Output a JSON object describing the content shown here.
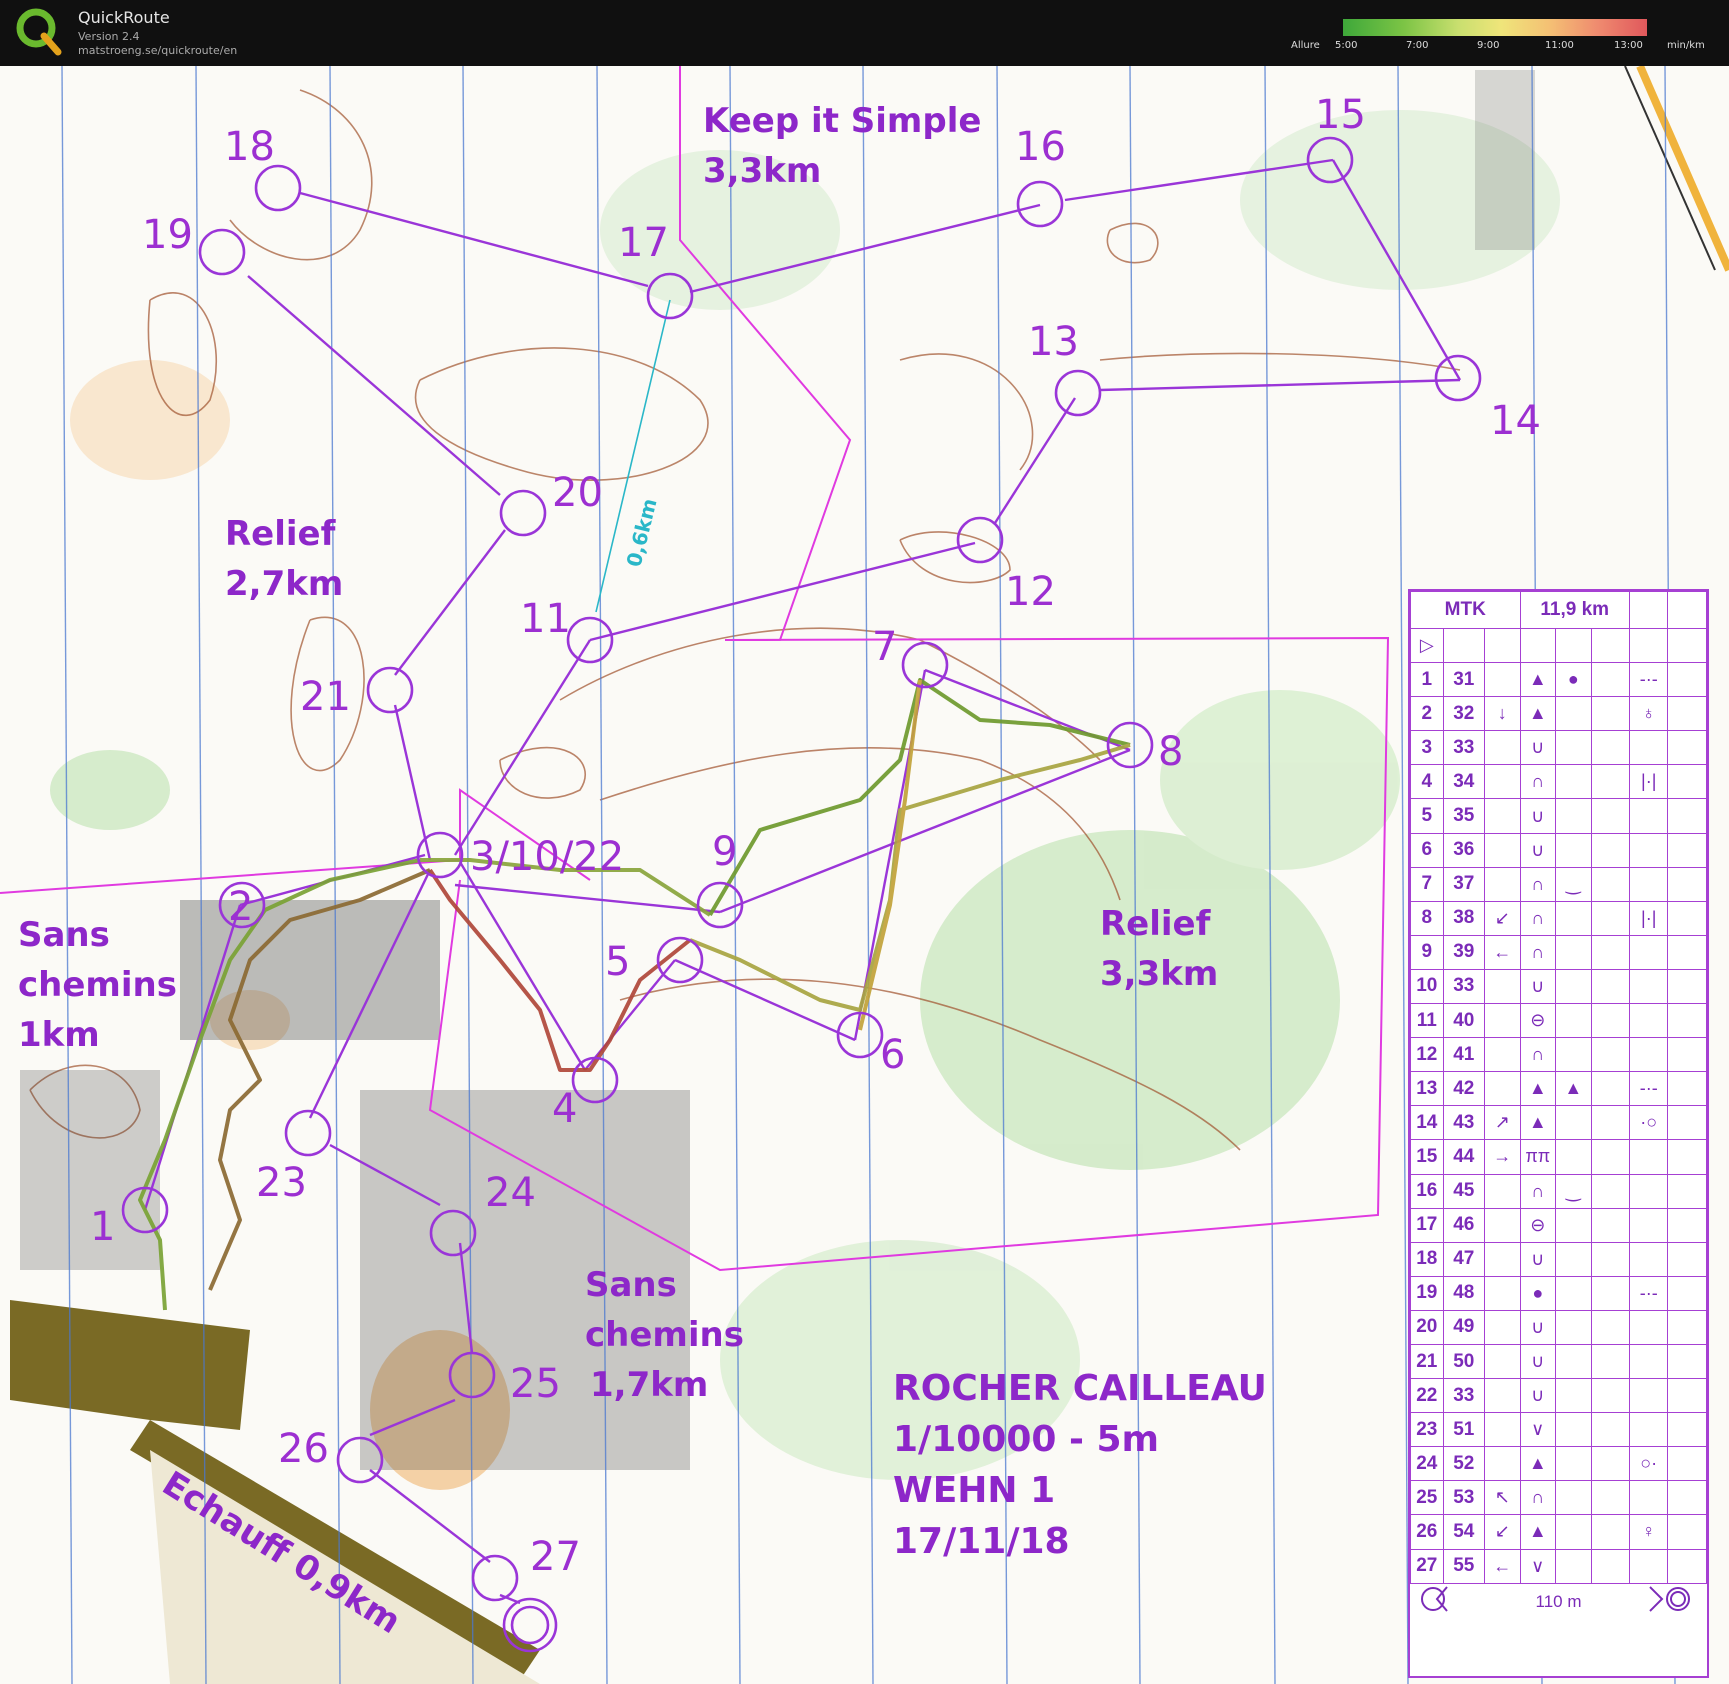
{
  "app": {
    "name": "QuickRoute",
    "version": "Version 2.4",
    "url": "matstroeng.se/quickroute/en"
  },
  "pace_legend": {
    "label": "Allure",
    "ticks": [
      "5:00",
      "7:00",
      "9:00",
      "11:00",
      "13:00"
    ],
    "unit": "min/km"
  },
  "map": {
    "sections": [
      {
        "line1": "Keep it Simple",
        "line2": "3,3km"
      },
      {
        "line1": "Relief",
        "line2": "2,7km"
      },
      {
        "line1": "Relief",
        "line2": "3,3km"
      },
      {
        "line1": "Sans",
        "line2": "chemins",
        "line3": "1km"
      },
      {
        "line1": "Sans",
        "line2": "chemins",
        "line3": "1,7km"
      }
    ],
    "warmup": "Echauff 0,9km",
    "leg_distance": "0,6km",
    "map_info": [
      "ROCHER CAILLEAU",
      "1/10000 - 5m",
      "WEHN 1",
      "17/11/18"
    ],
    "control_labels": [
      "1",
      "2",
      "3/10/22",
      "4",
      "5",
      "6",
      "7",
      "8",
      "9",
      "11",
      "12",
      "13",
      "14",
      "15",
      "16",
      "17",
      "18",
      "19",
      "20",
      "21",
      "23",
      "24",
      "25",
      "26",
      "27"
    ]
  },
  "control_description": {
    "event": "MTK",
    "length": "11,9 km",
    "rows": [
      {
        "n": "1",
        "code": "31",
        "dir": "",
        "feat": "▲",
        "appear": "●",
        "loc": "-·-"
      },
      {
        "n": "2",
        "code": "32",
        "dir": "↓",
        "feat": "▲",
        "appear": "",
        "loc": "♁"
      },
      {
        "n": "3",
        "code": "33",
        "dir": "",
        "feat": "∪",
        "appear": "",
        "loc": ""
      },
      {
        "n": "4",
        "code": "34",
        "dir": "",
        "feat": "∩",
        "appear": "",
        "loc": "|·|"
      },
      {
        "n": "5",
        "code": "35",
        "dir": "",
        "feat": "∪",
        "appear": "",
        "loc": ""
      },
      {
        "n": "6",
        "code": "36",
        "dir": "",
        "feat": "∪",
        "appear": "",
        "loc": ""
      },
      {
        "n": "7",
        "code": "37",
        "dir": "",
        "feat": "∩",
        "appear": "‿",
        "loc": ""
      },
      {
        "n": "8",
        "code": "38",
        "dir": "↙",
        "feat": "∩",
        "appear": "",
        "loc": "|·|"
      },
      {
        "n": "9",
        "code": "39",
        "dir": "←",
        "feat": "∩",
        "appear": "",
        "loc": ""
      },
      {
        "n": "10",
        "code": "33",
        "dir": "",
        "feat": "∪",
        "appear": "",
        "loc": ""
      },
      {
        "n": "11",
        "code": "40",
        "dir": "",
        "feat": "⊖",
        "appear": "",
        "loc": ""
      },
      {
        "n": "12",
        "code": "41",
        "dir": "",
        "feat": "∩",
        "appear": "",
        "loc": ""
      },
      {
        "n": "13",
        "code": "42",
        "dir": "",
        "feat": "▲",
        "appear": "▲",
        "loc": "-·-"
      },
      {
        "n": "14",
        "code": "43",
        "dir": "↗",
        "feat": "▲",
        "appear": "",
        "loc": "·○"
      },
      {
        "n": "15",
        "code": "44",
        "dir": "→",
        "feat": "ππ",
        "appear": "",
        "loc": ""
      },
      {
        "n": "16",
        "code": "45",
        "dir": "",
        "feat": "∩",
        "appear": "‿",
        "loc": ""
      },
      {
        "n": "17",
        "code": "46",
        "dir": "",
        "feat": "⊖",
        "appear": "",
        "loc": ""
      },
      {
        "n": "18",
        "code": "47",
        "dir": "",
        "feat": "∪",
        "appear": "",
        "loc": ""
      },
      {
        "n": "19",
        "code": "48",
        "dir": "",
        "feat": "●",
        "appear": "",
        "loc": "-·-"
      },
      {
        "n": "20",
        "code": "49",
        "dir": "",
        "feat": "∪",
        "appear": "",
        "loc": ""
      },
      {
        "n": "21",
        "code": "50",
        "dir": "",
        "feat": "∪",
        "appear": "",
        "loc": ""
      },
      {
        "n": "22",
        "code": "33",
        "dir": "",
        "feat": "∪",
        "appear": "",
        "loc": ""
      },
      {
        "n": "23",
        "code": "51",
        "dir": "",
        "feat": "∨",
        "appear": "",
        "loc": ""
      },
      {
        "n": "24",
        "code": "52",
        "dir": "",
        "feat": "▲",
        "appear": "",
        "loc": "○·"
      },
      {
        "n": "25",
        "code": "53",
        "dir": "↖",
        "feat": "∩",
        "appear": "",
        "loc": ""
      },
      {
        "n": "26",
        "code": "54",
        "dir": "↙",
        "feat": "▲",
        "appear": "",
        "loc": "♀"
      },
      {
        "n": "27",
        "code": "55",
        "dir": "←",
        "feat": "∨",
        "appear": "",
        "loc": ""
      }
    ],
    "finish_distance": "110 m"
  }
}
